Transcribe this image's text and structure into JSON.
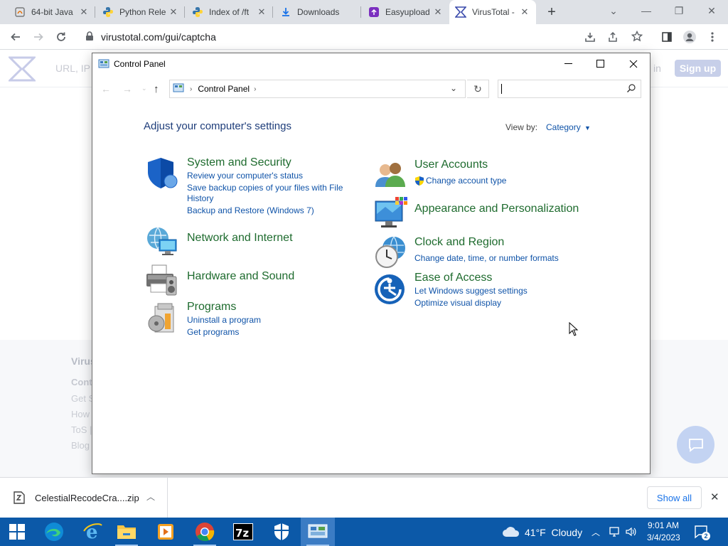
{
  "browser": {
    "tabs": [
      {
        "title": "64-bit Java",
        "icon": "java-icon"
      },
      {
        "title": "Python Rele",
        "icon": "python-icon"
      },
      {
        "title": "Index of /ft",
        "icon": "python-icon"
      },
      {
        "title": "Downloads",
        "icon": "download-icon"
      },
      {
        "title": "Easyupload",
        "icon": "easyupload-icon"
      },
      {
        "title": "VirusTotal -",
        "icon": "virustotal-icon",
        "active": true
      }
    ],
    "new_tab_symbol": "+",
    "url": "virustotal.com/gui/captcha"
  },
  "vt_page": {
    "search_placeholder": "URL, IP",
    "sign_in": "in",
    "sign_up": "Sign up",
    "footer_heading": "Virus",
    "footer_links": [
      "Cont",
      "Get S",
      "How",
      "ToS |",
      "Blog"
    ]
  },
  "control_panel": {
    "window_title": "Control Panel",
    "breadcrumb": "Control Panel",
    "heading": "Adjust your computer's settings",
    "view_by_label": "View by:",
    "view_by_value": "Category",
    "left_categories": [
      {
        "title": "System and Security",
        "icon": "shield-icon",
        "links": [
          "Review your computer's status",
          "Save backup copies of your files with File",
          "History",
          "Backup and Restore (Windows 7)"
        ]
      },
      {
        "title": "Network and Internet",
        "icon": "network-globe-icon",
        "links": []
      },
      {
        "title": "Hardware and Sound",
        "icon": "printer-icon",
        "links": []
      },
      {
        "title": "Programs",
        "icon": "programs-icon",
        "links": [
          "Uninstall a program",
          "Get programs"
        ]
      }
    ],
    "right_categories": [
      {
        "title": "User Accounts",
        "icon": "users-icon",
        "links": [
          "Change account type"
        ]
      },
      {
        "title": "Appearance and Personalization",
        "icon": "monitor-palette-icon",
        "links": []
      },
      {
        "title": "Clock and Region",
        "icon": "clock-globe-icon",
        "links": [
          "Change date, time, or number formats"
        ]
      },
      {
        "title": "Ease of Access",
        "icon": "ease-access-icon",
        "links": [
          "Let Windows suggest settings",
          "Optimize visual display"
        ]
      }
    ]
  },
  "download_bar": {
    "file_name": "CelestialRecodeCra....zip",
    "show_all": "Show all"
  },
  "taskbar": {
    "weather": "41°F  Cloudy",
    "time": "9:01 AM",
    "date": "3/4/2023",
    "notification_count": "2"
  },
  "colors": {
    "taskbar": "#0c59a8",
    "cp_green": "#1e6b2e",
    "cp_link": "#0f53a8",
    "cp_heading": "#1e3d7a"
  }
}
